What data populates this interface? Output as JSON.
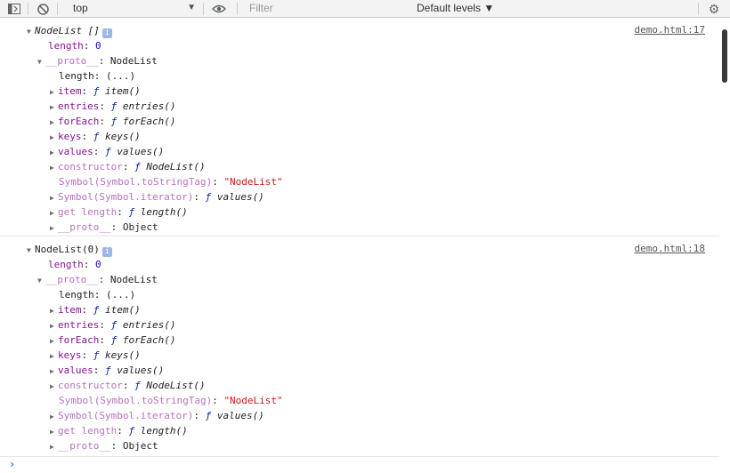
{
  "toolbar": {
    "context": "top",
    "filter_placeholder": "Filter",
    "levels": "Default levels ▼"
  },
  "messages": [
    {
      "source": "demo.html:17",
      "header": "NodeList []",
      "length_key": "length",
      "length_val": "0",
      "proto_key": "__proto__",
      "proto_val": "NodeList",
      "proto_length": "length: (...)",
      "item_key": "item",
      "item_fn": "item()",
      "entries_key": "entries",
      "entries_fn": "entries()",
      "foreach_key": "forEach",
      "foreach_fn": "forEach()",
      "keys_key": "keys",
      "keys_fn": "keys()",
      "values_key": "values",
      "values_fn": "values()",
      "constructor_key": "constructor",
      "constructor_fn": "NodeList()",
      "tostringtag_key": "Symbol(Symbol.toStringTag)",
      "tostringtag_val": "\"NodeList\"",
      "iterator_key": "Symbol(Symbol.iterator)",
      "iterator_fn": "values()",
      "getlength_key": "get length",
      "getlength_fn": "length()",
      "proto2_key": "__proto__",
      "proto2_val": "Object"
    },
    {
      "source": "demo.html:18",
      "header": "NodeList(0)",
      "length_key": "length",
      "length_val": "0",
      "proto_key": "__proto__",
      "proto_val": "NodeList",
      "proto_length": "length: (...)",
      "item_key": "item",
      "item_fn": "item()",
      "entries_key": "entries",
      "entries_fn": "entries()",
      "foreach_key": "forEach",
      "foreach_fn": "forEach()",
      "keys_key": "keys",
      "keys_fn": "keys()",
      "values_key": "values",
      "values_fn": "values()",
      "constructor_key": "constructor",
      "constructor_fn": "NodeList()",
      "tostringtag_key": "Symbol(Symbol.toStringTag)",
      "tostringtag_val": "\"NodeList\"",
      "iterator_key": "Symbol(Symbol.iterator)",
      "iterator_fn": "values()",
      "getlength_key": "get length",
      "getlength_fn": "length()",
      "proto2_key": "__proto__",
      "proto2_val": "Object"
    }
  ],
  "prompt": "›"
}
